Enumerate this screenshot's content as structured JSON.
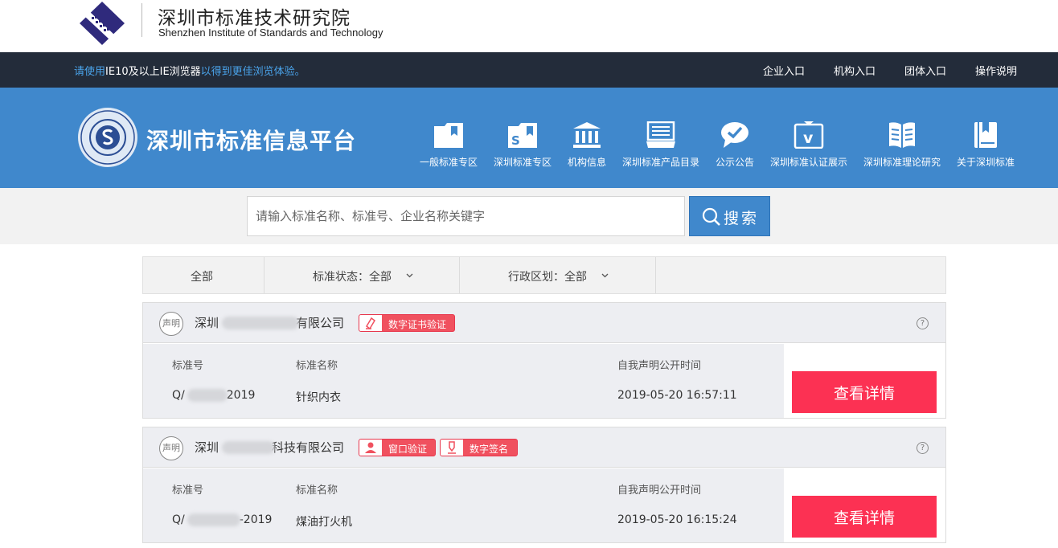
{
  "institute": {
    "name_cn": "深圳市标准技术研究院",
    "name_en": "Shenzhen Institute of Standards and Technology"
  },
  "topbar": {
    "tip_part1": "请使用",
    "tip_highlight": "IE10及以上IE浏览器",
    "tip_part2": "以得到更佳浏览体验。",
    "links": [
      "企业入口",
      "机构入口",
      "团体入口",
      "操作说明"
    ]
  },
  "platform": {
    "title": "深圳市标准信息平台",
    "nav": [
      {
        "label": "一般标准专区",
        "icon": "folder-bookmark-icon"
      },
      {
        "label": "深圳标准专区",
        "icon": "folder-s-icon"
      },
      {
        "label": "机构信息",
        "icon": "institution-building-icon"
      },
      {
        "label": "深圳标准产品目录",
        "icon": "catalog-tray-icon"
      },
      {
        "label": "公示公告",
        "icon": "chat-check-icon"
      },
      {
        "label": "深圳标准认证展示",
        "icon": "certification-v-icon"
      },
      {
        "label": "深圳标准理论研究",
        "icon": "open-book-icon"
      },
      {
        "label": "关于深圳标准",
        "icon": "bookmark-book-icon"
      }
    ]
  },
  "search": {
    "placeholder": "请输入标准名称、标准号、企业名称关键字",
    "button_label": "搜索"
  },
  "filters": {
    "all": "全部",
    "status_label": "标准状态：",
    "status_value": "全部",
    "region_label": "行政区划：",
    "region_value": "全部"
  },
  "cards": [
    {
      "badge": "声明",
      "company_prefix": "深圳",
      "company_suffix": "有限公司",
      "tags": [
        {
          "label": "数字证书验证",
          "icon": "certificate-icon"
        }
      ],
      "col_std_no": "标准号",
      "col_std_name": "标准名称",
      "col_time": "自我声明公开时间",
      "std_no_prefix": "Q/",
      "std_no_suffix": "2019",
      "std_name": "针织内衣",
      "time": "2019-05-20 16:57:11",
      "detail_label": "查看详情"
    },
    {
      "badge": "声明",
      "company_prefix": "深圳",
      "company_suffix": "科技有限公司",
      "tags": [
        {
          "label": "窗口验证",
          "icon": "person-icon"
        },
        {
          "label": "数字签名",
          "icon": "pen-signature-icon"
        }
      ],
      "col_std_no": "标准号",
      "col_std_name": "标准名称",
      "col_time": "自我声明公开时间",
      "std_no_prefix": "Q/",
      "std_no_suffix": "-2019",
      "std_name": "煤油打火机",
      "time": "2019-05-20 16:15:24",
      "detail_label": "查看详情"
    }
  ],
  "colors": {
    "topbar_bg": "#232c3a",
    "primary_blue": "#4088cc",
    "detail_red": "#fc3153",
    "tag_red": "#f0515f",
    "tip_blue": "#4aa3ea"
  }
}
